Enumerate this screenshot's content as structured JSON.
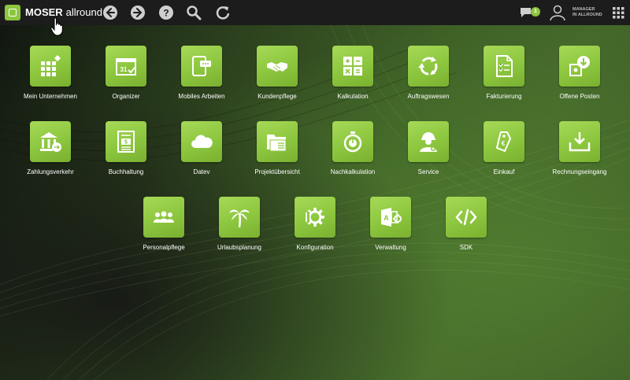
{
  "topbar": {
    "brand_bold": "MOSER",
    "brand_light": "allround",
    "badge_count": "1",
    "user_line1": "MANAGER",
    "user_line2": "IN ALLROUND"
  },
  "tiles": [
    {
      "label": "Mein Unternehmen",
      "icon": "grid-diamond-icon"
    },
    {
      "label": "Organizer",
      "icon": "calendar-icon"
    },
    {
      "label": "Mobiles Arbeiten",
      "icon": "tablet-icon"
    },
    {
      "label": "Kundenpflege",
      "icon": "handshake-icon"
    },
    {
      "label": "Kalkulation",
      "icon": "calculator-icon"
    },
    {
      "label": "Auftragswesen",
      "icon": "recycle-arrows-icon"
    },
    {
      "label": "Fakturierung",
      "icon": "invoice-icon"
    },
    {
      "label": "Offene Posten",
      "icon": "open-items-icon"
    },
    {
      "label": "Zahlungsverkehr",
      "icon": "bank-icon"
    },
    {
      "label": "Buchhaltung",
      "icon": "ledger-icon"
    },
    {
      "label": "Datev",
      "icon": "cloud-icon"
    },
    {
      "label": "Projektübersicht",
      "icon": "folder-icon"
    },
    {
      "label": "Nachkalkulation",
      "icon": "stopwatch-icon"
    },
    {
      "label": "Service",
      "icon": "technician-icon"
    },
    {
      "label": "Einkauf",
      "icon": "price-tag-icon"
    },
    {
      "label": "Rechnungseingang",
      "icon": "inbox-download-icon"
    },
    {
      "label": "Personalpflege",
      "icon": "people-icon"
    },
    {
      "label": "Urlaubsplanung",
      "icon": "palm-tree-icon"
    },
    {
      "label": "Konfiguration",
      "icon": "gear-icon"
    },
    {
      "label": "Verwaltung",
      "icon": "admin-app-icon"
    },
    {
      "label": "SDK",
      "icon": "code-icon"
    }
  ]
}
